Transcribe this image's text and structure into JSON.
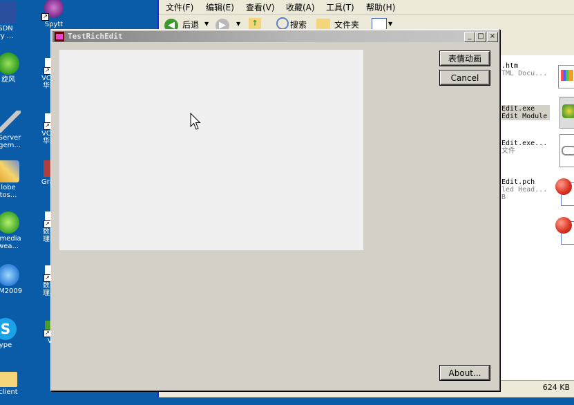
{
  "desktop": {
    "icons": [
      {
        "line1": "SDN",
        "line2": "ry ..."
      },
      {
        "line1": "Spytt",
        "line2": ""
      },
      {
        "line1": "旋风",
        "line2": ""
      },
      {
        "line1": "VC知",
        "line2": "华珍"
      },
      {
        "line1": "Server",
        "line2": "gem..."
      },
      {
        "line1": "VC知",
        "line2": "华珍"
      },
      {
        "line1": "lobe",
        "line2": "tos..."
      },
      {
        "line1": "Grap",
        "line2": ""
      },
      {
        "line1": "omedia",
        "line2": "wea..."
      },
      {
        "line1": "数据",
        "line2": "理与"
      },
      {
        "line1": "TM2009",
        "line2": ""
      },
      {
        "line1": "数字",
        "line2": "理典"
      },
      {
        "line1": "ype",
        "line2": ""
      },
      {
        "line1": "V",
        "line2": ""
      },
      {
        "line1": "client",
        "line2": ""
      }
    ]
  },
  "explorer": {
    "menu": [
      "文件(F)",
      "编辑(E)",
      "查看(V)",
      "收藏(A)",
      "工具(T)",
      "帮助(H)"
    ],
    "toolbar": {
      "back": "后退",
      "search": "搜索",
      "folders": "文件夹"
    },
    "files": [
      {
        "name": ".htm",
        "type": "TML Docu..."
      },
      {
        "name": "Edit.exe",
        "type": "Edit Module"
      },
      {
        "name": "Edit.exe...",
        "type": "文件"
      },
      {
        "name": "Edit.pch",
        "type": "led Head...",
        "extra": "B"
      }
    ],
    "status_size": "624 KB"
  },
  "dialog": {
    "title": "TestRichEdit",
    "minimize": "_",
    "maximize": "□",
    "close": "×",
    "btn_emoticon": "表情动画",
    "btn_cancel": "Cancel",
    "btn_about": "About..."
  }
}
